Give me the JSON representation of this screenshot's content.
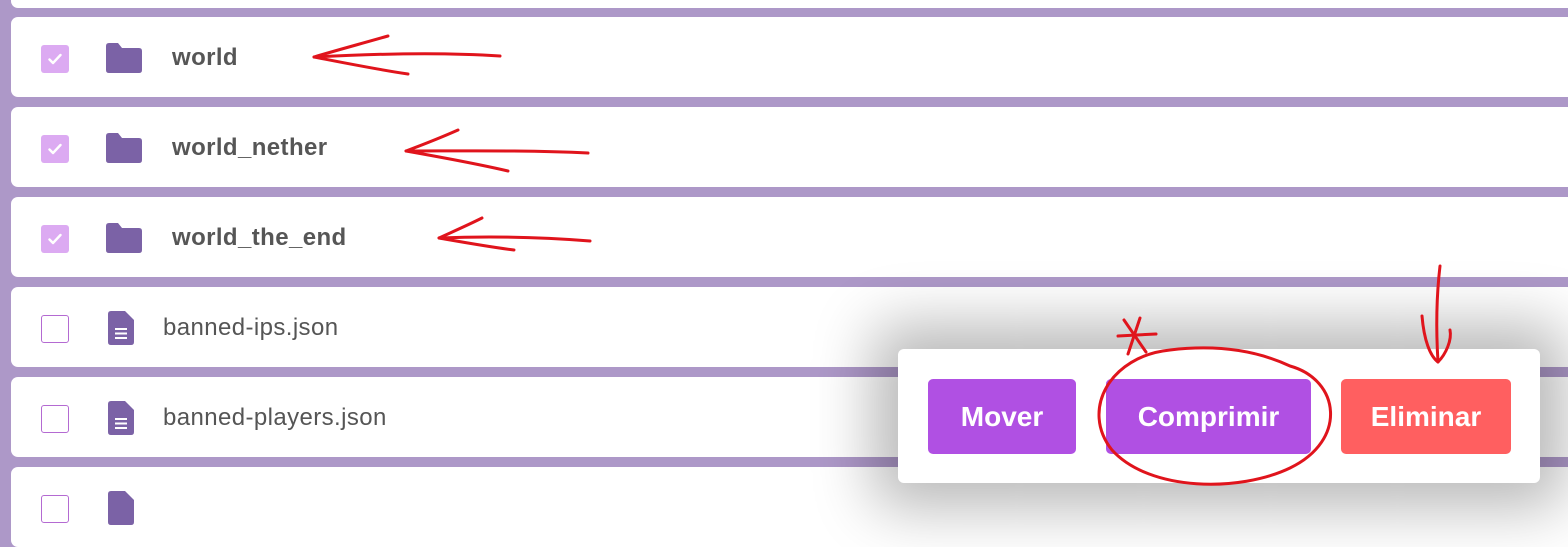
{
  "files": [
    {
      "name": "world",
      "type": "folder",
      "checked": true
    },
    {
      "name": "world_nether",
      "type": "folder",
      "checked": true
    },
    {
      "name": "world_the_end",
      "type": "folder",
      "checked": true
    },
    {
      "name": "banned-ips.json",
      "type": "file",
      "checked": false
    },
    {
      "name": "banned-players.json",
      "type": "file",
      "checked": false
    },
    {
      "name": "",
      "type": "file",
      "checked": false
    }
  ],
  "actions": {
    "move_label": "Mover",
    "compress_label": "Comprimir",
    "delete_label": "Eliminar"
  },
  "colors": {
    "background": "#ad98c8",
    "checkbox_checked": "#dcaaf2",
    "icon": "#7b62a6",
    "primary_button": "#b050e3",
    "danger_button": "#ff5f60",
    "annotation": "#e0141c"
  },
  "icons": {
    "folder": "folder-icon",
    "file": "document-icon",
    "check": "checkmark-icon"
  }
}
